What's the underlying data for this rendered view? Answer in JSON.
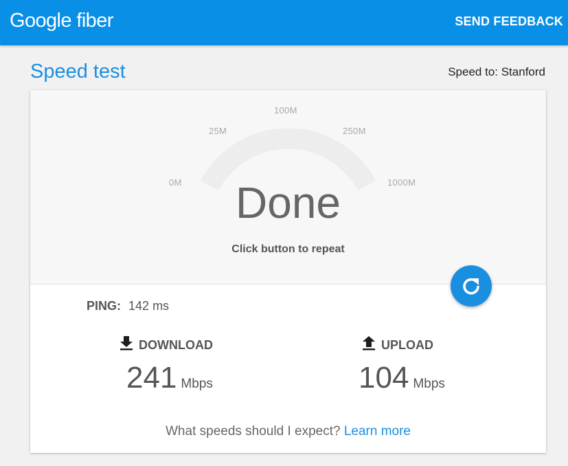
{
  "header": {
    "brand": "Google fiber",
    "feedback_label": "SEND FEEDBACK"
  },
  "page": {
    "title": "Speed test",
    "speed_to": "Speed to: Stanford"
  },
  "gauge": {
    "ticks": [
      "0M",
      "25M",
      "100M",
      "250M",
      "1000M"
    ],
    "status": "Done",
    "instruction": "Click button to repeat"
  },
  "results": {
    "ping_label": "PING:",
    "ping_value": "142 ms",
    "download_label": "DOWNLOAD",
    "download_value": "241",
    "download_unit": "Mbps",
    "upload_label": "UPLOAD",
    "upload_value": "104",
    "upload_unit": "Mbps"
  },
  "footer": {
    "question": "What speeds should I expect?",
    "link": "Learn more"
  },
  "icons": {
    "refresh": "refresh-icon",
    "download": "download-icon",
    "upload": "upload-icon"
  },
  "colors": {
    "brand_blue": "#0a8fe6",
    "accent_blue": "#1a8fe0"
  }
}
